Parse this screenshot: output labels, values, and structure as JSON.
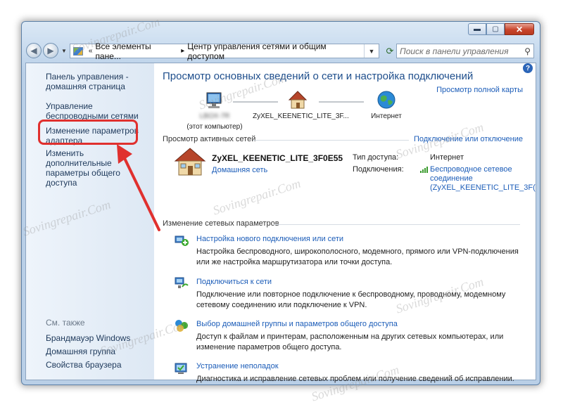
{
  "window": {
    "minimize": "▬",
    "maximize": "▢",
    "close": "✕"
  },
  "navbar": {
    "back_icon": "arrow-left-icon",
    "forward_icon": "arrow-right-icon",
    "breadcrumb": [
      "Все элементы пане...",
      "Центр управления сетями и общим доступом"
    ],
    "search_placeholder": "Поиск в панели управления"
  },
  "sidebar": {
    "items": [
      {
        "label": "Панель управления - домашняя страница"
      },
      {
        "label": "Управление беспроводными сетями"
      },
      {
        "label": "Изменение параметров адаптера"
      },
      {
        "label": "Изменить дополнительные параметры общего доступа"
      }
    ],
    "see_also_heading": "См. также",
    "see_also": [
      {
        "label": "Брандмауэр Windows"
      },
      {
        "label": "Домашняя группа"
      },
      {
        "label": "Свойства браузера"
      }
    ]
  },
  "main": {
    "title": "Просмотр основных сведений о сети и настройка подключений",
    "full_map_link": "Просмотр полной карты",
    "map": {
      "computer_name": "LBOX-7R",
      "computer_caption": "(этот компьютер)",
      "router_name": "ZyXEL_KEENETIC_LITE_3F...",
      "internet": "Интернет"
    },
    "active_networks": {
      "heading": "Просмотр активных сетей",
      "connect_link": "Подключение или отключение",
      "network_name": "ZyXEL_KEENETIC_LITE_3F0E55",
      "network_type": "Домашняя сеть",
      "access_type_label": "Тип доступа:",
      "access_type_value": "Интернет",
      "connections_label": "Подключения:",
      "connection_line1": "Беспроводное сетевое",
      "connection_line2": "соединение",
      "connection_line3": "(ZyXEL_KEENETIC_LITE_3F("
    },
    "change_settings": {
      "heading": "Изменение сетевых параметров",
      "tasks": [
        {
          "icon": "new-connection-icon",
          "title": "Настройка нового подключения или сети",
          "desc": "Настройка беспроводного, широкополосного, модемного, прямого или VPN-подключения или же настройка маршрутизатора или точки доступа."
        },
        {
          "icon": "connect-network-icon",
          "title": "Подключиться к сети",
          "desc": "Подключение или повторное подключение к беспроводному, проводному, модемному сетевому соединению или подключение к VPN."
        },
        {
          "icon": "homegroup-icon",
          "title": "Выбор домашней группы и параметров общего доступа",
          "desc": "Доступ к файлам и принтерам, расположенным на других сетевых компьютерах, или изменение параметров общего доступа."
        },
        {
          "icon": "troubleshoot-icon",
          "title": "Устранение неполадок",
          "desc": "Диагностика и исправление сетевых проблем или получение сведений об исправлении."
        }
      ]
    }
  },
  "watermark": "Sovingrepair.Com",
  "colors": {
    "link": "#1b5cb8",
    "highlight": "#e0302e",
    "title": "#1e4e8c"
  }
}
